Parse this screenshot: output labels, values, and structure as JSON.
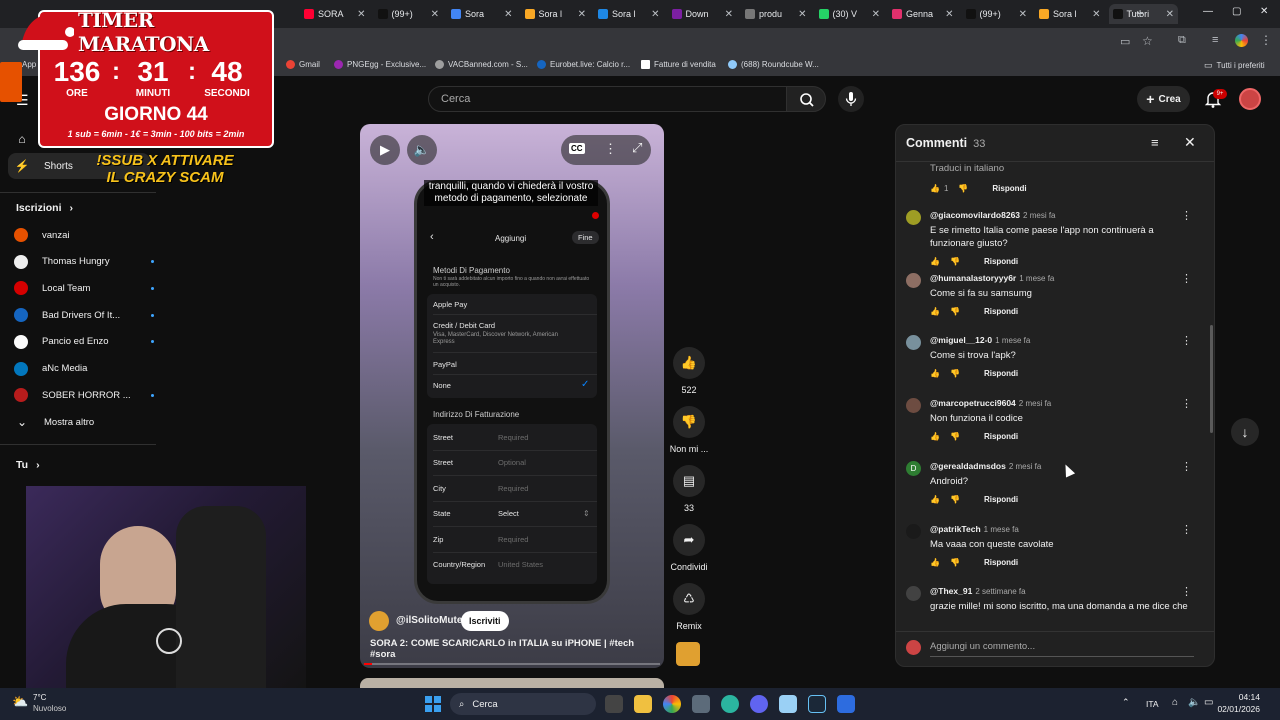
{
  "browser": {
    "tabs": [
      {
        "label": "TIMER MARATONA",
        "color": "#e53935"
      },
      {
        "label": "SORA",
        "color": "#ff0033"
      },
      {
        "label": "(99+)",
        "color": "#111111"
      },
      {
        "label": "Sora",
        "color": "#4285f4"
      },
      {
        "label": "Sora l",
        "color": "#f9a825"
      },
      {
        "label": "Sora l",
        "color": "#1e88e5"
      },
      {
        "label": "Down",
        "color": "#7b1fa2"
      },
      {
        "label": "produ",
        "color": "#777777"
      },
      {
        "label": "(30) V",
        "color": "#25d366"
      },
      {
        "label": "Genna",
        "color": "#e1306c"
      },
      {
        "label": "(99+)",
        "color": "#111111"
      },
      {
        "label": "Sora l",
        "color": "#f9a825"
      },
      {
        "label": "Tutori",
        "color": "#111111",
        "active": true
      }
    ],
    "bookmarks": [
      "Gmail",
      "PNGEgg - Exclusive...",
      "VACBanned.com - S...",
      "Eurobet.live: Calcio r...",
      "Fatture di vendita",
      "(688) Roundcube W..."
    ],
    "all_bookmarks": "Tutti i preferiti",
    "apps_label": "App"
  },
  "header": {
    "search_placeholder": "Cerca",
    "create_label": "Crea",
    "notif_badge": "9+"
  },
  "overlay": {
    "title": "TIMER MARATONA",
    "hours": "136",
    "minutes": "31",
    "seconds": "48",
    "hours_label": "ORE",
    "minutes_label": "MINUTI",
    "seconds_label": "SECONDI",
    "day": "GIORNO 44",
    "rates": "1 sub = 6min - 1€ = 3min - 100 bits = 2min",
    "promo": "!SSUB X ATTIVARE IL CRAZY SCAM"
  },
  "sidebar": {
    "shorts": "Shorts",
    "subscriptions": "Iscrizioni",
    "channels": [
      {
        "name": "vanzai",
        "color": "#e65100",
        "live": false
      },
      {
        "name": "Thomas Hungry",
        "color": "#eeeeee",
        "live": true
      },
      {
        "name": "Local Team",
        "color": "#d50000",
        "live": true
      },
      {
        "name": "Bad Drivers Of It...",
        "color": "#1565c0",
        "live": true
      },
      {
        "name": "Pancio ed Enzo",
        "color": "#fafafa",
        "live": true
      },
      {
        "name": "aNc Media",
        "color": "#0277bd",
        "live": false
      },
      {
        "name": "SOBER HORROR ...",
        "color": "#b71c1c",
        "live": true
      }
    ],
    "show_more": "Mostra altro",
    "you": "Tu"
  },
  "short": {
    "caption": "tranquilli, quando vi chiederà il vostro metodo di pagamento, selezionate",
    "phone": {
      "header": "Aggiungi",
      "done": "Fine",
      "section_payment": "Metodi Di Pagamento",
      "section_payment_note": "Non ti sarà addebitato alcun importo fino a quando non avrai effettuato un acquisto.",
      "apple_pay": "Apple Pay",
      "card": "Credit / Debit Card",
      "card_note": "Visa, MasterCard, Discover Network, American Express",
      "paypal": "PayPal",
      "none": "None",
      "section_billing": "Indirizzo Di Fatturazione",
      "fields": [
        {
          "label": "Street",
          "value": "Required"
        },
        {
          "label": "Street",
          "value": "Optional"
        },
        {
          "label": "City",
          "value": "Required"
        },
        {
          "label": "State",
          "value": "Select"
        },
        {
          "label": "Zip",
          "value": "Required"
        },
        {
          "label": "Country/Region",
          "value": "United States"
        }
      ]
    },
    "channel": "@ilSolitoMute",
    "subscribe": "Iscriviti",
    "title": "SORA 2: COME SCARICARLO in ITALIA su iPHONE | #tech #sora",
    "likes": "522",
    "dislike_label": "Non mi ...",
    "comments_count": "33",
    "share_label": "Condividi",
    "remix_label": "Remix"
  },
  "comments": {
    "title": "Commenti",
    "count": "33",
    "translate": "Traduci in italiano",
    "top_like": "1",
    "reply_label": "Rispondi",
    "add_placeholder": "Aggiungi un commento...",
    "items": [
      {
        "user": "@giacomovilardo8263",
        "time": "2 mesi fa",
        "text": "E se rimetto Italia come paese l'app non continuerà a funzionare giusto?",
        "color": "#9e9d24"
      },
      {
        "user": "@humanalastoryyy6r",
        "time": "1 mese fa",
        "text": "Come si fa su samsumg",
        "color": "#8d6e63"
      },
      {
        "user": "@miguel__12-0",
        "time": "1 mese fa",
        "text": "Come si trova l'apk?",
        "color": "#78909c"
      },
      {
        "user": "@marcopetrucci9604",
        "time": "2 mesi fa",
        "text": "Non funziona il codice",
        "color": "#6d4c41"
      },
      {
        "user": "@gerealdadmsdos",
        "time": "2 mesi fa",
        "text": "Android?",
        "color": "#2e7d32",
        "initial": "D"
      },
      {
        "user": "@patrikTech",
        "time": "1 mese fa",
        "text": "Ma vaaa con queste cavolate",
        "color": "#1a1a1a"
      },
      {
        "user": "@Thex_91",
        "time": "2 settimane fa",
        "text": "grazie mille! mi sono iscritto, ma una domanda a me dice che",
        "color": "#424242"
      }
    ]
  },
  "taskbar": {
    "weather_temp": "7°C",
    "weather_desc": "Nuvoloso",
    "search": "Cerca",
    "lang": "ITA",
    "time": "04:14",
    "date": "02/01/2026"
  }
}
